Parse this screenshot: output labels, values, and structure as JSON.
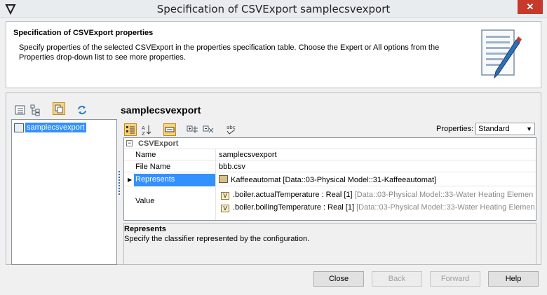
{
  "window": {
    "title": "Specification of CSVExport samplecsvexport",
    "close_glyph": "✕"
  },
  "header": {
    "title": "Specification of CSVExport properties",
    "description": "Specify properties of the selected CSVExport in the properties specification table. Choose the Expert or All options from the Properties drop-down list to see more properties."
  },
  "tree": {
    "items": [
      {
        "label": "samplecsvexport"
      }
    ]
  },
  "element_title": "samplecsvexport",
  "properties": {
    "label": "Properties:",
    "selected": "Standard"
  },
  "grid": {
    "group": "CSVExport",
    "rows": [
      {
        "name": "Name",
        "value": "samplecsvexport"
      },
      {
        "name": "File Name",
        "value": "bbb.csv"
      },
      {
        "name": "Represents",
        "value": "Kaffeeautomat [Data::03-Physical Model::31-Kaffeeautomat]"
      },
      {
        "name": "Value",
        "values": [
          {
            "badge": "V",
            "text": ".boiler.actualTemperature : Real [1]",
            "path": "[Data::03-Physical Model::33-Water Heating Elemen"
          },
          {
            "badge": "V",
            "text": ".boiler.boilingTemperature : Real [1]",
            "path": "[Data::03-Physical Model::33-Water Heating Elemen"
          }
        ]
      }
    ]
  },
  "description": {
    "title": "Represents",
    "text": "Specify the classifier represented by the configuration."
  },
  "buttons": {
    "close": "Close",
    "back": "Back",
    "forward": "Forward",
    "help": "Help"
  }
}
